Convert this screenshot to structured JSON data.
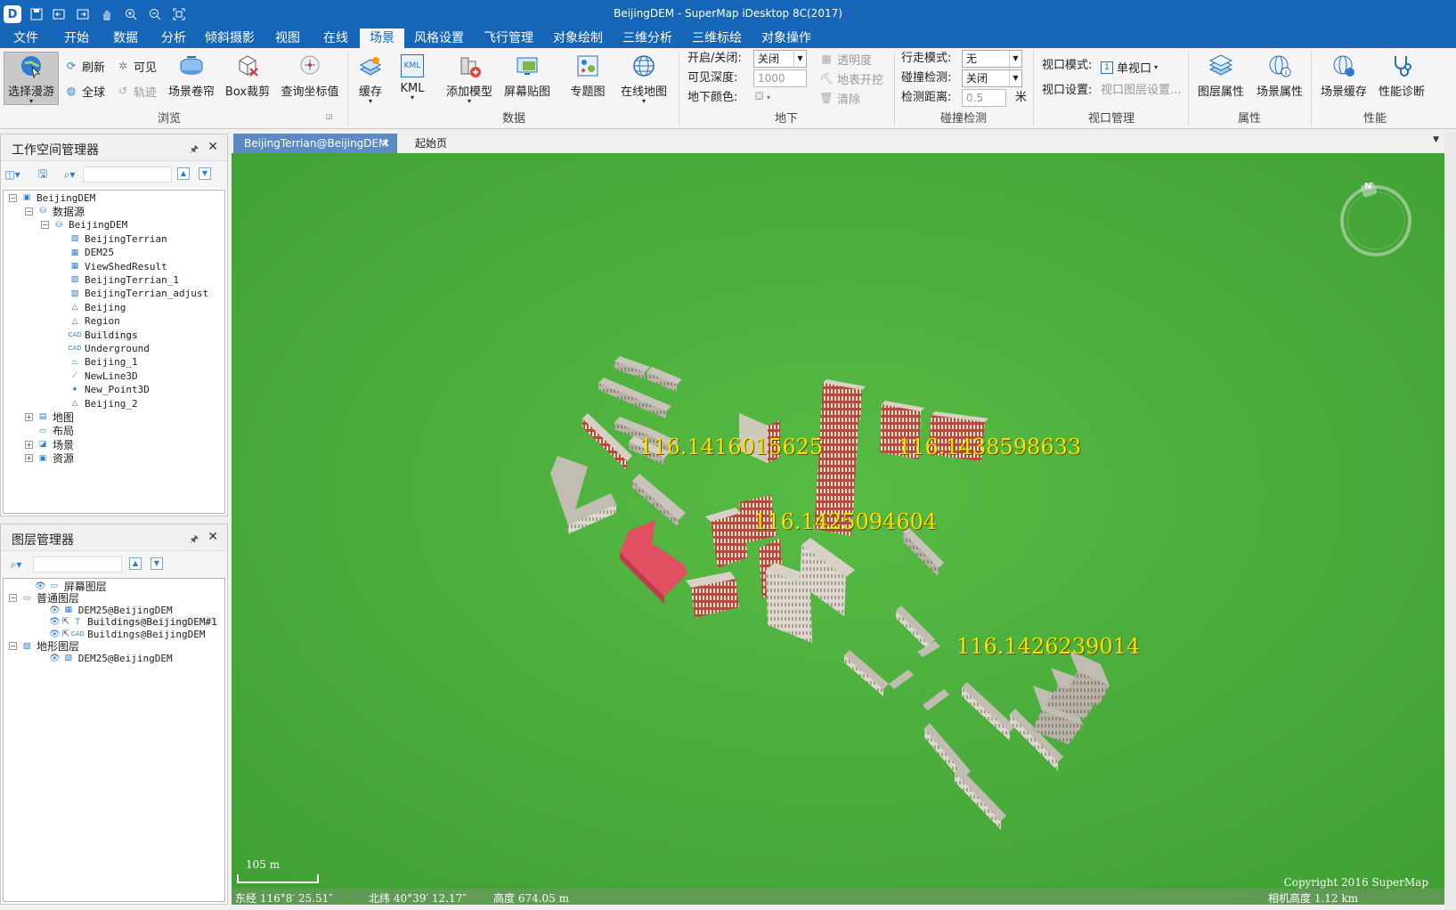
{
  "window": {
    "title": "BeijingDEM - SuperMap iDesktop 8C(2017)",
    "logo_text": "D"
  },
  "quick_access": [
    {
      "icon": "save-icon",
      "glyph": "🖫"
    },
    {
      "icon": "back-icon",
      "glyph": "⇤"
    },
    {
      "icon": "forward-icon",
      "glyph": "⇥"
    },
    {
      "icon": "pan-hand-icon",
      "glyph": "✋"
    },
    {
      "icon": "zoom-in-icon",
      "glyph": "⊕"
    },
    {
      "icon": "zoom-out-icon",
      "glyph": "⊖"
    },
    {
      "icon": "full-extent-icon",
      "glyph": "⛶"
    }
  ],
  "menu_tabs": [
    "文件",
    "开始",
    "数据",
    "分析",
    "倾斜摄影",
    "视图",
    "在线",
    "场景",
    "风格设置",
    "飞行管理",
    "对象绘制",
    "三维分析",
    "三维标绘",
    "对象操作"
  ],
  "active_menu_tab": "场景",
  "ribbon": {
    "browse": {
      "label": "浏览",
      "select_roam": "选择漫游",
      "refresh": "刷新",
      "visible": "可见",
      "full_globe": "全球",
      "track": "轨迹",
      "scene_roller": "场景卷帘",
      "box_clip": "Box裁剪",
      "query_coord": "查询坐标值"
    },
    "data": {
      "label": "数据",
      "cache": "缓存",
      "kml": "KML",
      "kml_icon_text": "KML",
      "add_model": "添加模型",
      "screen_paste": "屏幕贴图",
      "thematic": "专题图",
      "online_map": "在线地图"
    },
    "underground": {
      "label": "地下",
      "on_off_label": "开启/关闭:",
      "on_off_value": "关闭",
      "depth_label": "可见深度:",
      "depth_value": "1000",
      "color_label": "地下颜色:",
      "transparency": "透明度",
      "surface_dig": "地表开挖",
      "clear": "清除"
    },
    "collision": {
      "label": "碰撞检测",
      "walk_mode_label": "行走模式:",
      "walk_mode_value": "无",
      "collision_label": "碰撞检测:",
      "collision_value": "关闭",
      "distance_label": "检测距离:",
      "distance_value": "0.5",
      "unit": "米"
    },
    "viewport": {
      "label": "视口管理",
      "mode_label": "视口模式:",
      "mode_value": "单视口",
      "mode_icon_text": "1",
      "settings_label": "视口设置:",
      "settings_value": "视口图层设置..."
    },
    "properties": {
      "label": "属性",
      "layer_props": "图层属性",
      "scene_props": "场景属性"
    },
    "performance": {
      "label": "性能",
      "scene_cache": "场景缓存",
      "diagnosis": "性能诊断"
    }
  },
  "workspace_panel": {
    "title": "工作空间管理器",
    "pin_glyph": "🖈",
    "tree": [
      {
        "label": "BeijingDEM",
        "level": 0,
        "icon": "workspace-icon",
        "exp": "⊟",
        "cn": false
      },
      {
        "label": "数据源",
        "level": 1,
        "icon": "datasources-icon",
        "exp": "⊟",
        "cn": true
      },
      {
        "label": "BeijingDEM",
        "level": 2,
        "icon": "database-icon",
        "exp": "⊟",
        "cn": false
      },
      {
        "label": "BeijingTerrian",
        "level": 3,
        "icon": "image-dataset-icon",
        "exp": "",
        "cn": false
      },
      {
        "label": "DEM25",
        "level": 3,
        "icon": "grid-dataset-icon",
        "exp": "",
        "cn": false
      },
      {
        "label": "ViewShedResult",
        "level": 3,
        "icon": "grid-dataset-icon",
        "exp": "",
        "cn": false
      },
      {
        "label": "BeijingTerrian_1",
        "level": 3,
        "icon": "image-dataset-icon",
        "exp": "",
        "cn": false
      },
      {
        "label": "BeijingTerrian_adjust",
        "level": 3,
        "icon": "image-dataset-icon",
        "exp": "",
        "cn": false
      },
      {
        "label": "Beijing",
        "level": 3,
        "icon": "region-dataset-icon",
        "exp": "",
        "cn": false
      },
      {
        "label": "Region",
        "level": 3,
        "icon": "region-dataset-icon",
        "exp": "",
        "cn": false
      },
      {
        "label": "Buildings",
        "level": 3,
        "icon": "cad-dataset-icon",
        "exp": "",
        "cn": false,
        "hl": true
      },
      {
        "label": "Underground",
        "level": 3,
        "icon": "cad-dataset-icon",
        "exp": "",
        "cn": false
      },
      {
        "label": "Beijing_1",
        "level": 3,
        "icon": "region3d-dataset-icon",
        "exp": "",
        "cn": false
      },
      {
        "label": "NewLine3D",
        "level": 3,
        "icon": "line3d-dataset-icon",
        "exp": "",
        "cn": false
      },
      {
        "label": "New_Point3D",
        "level": 3,
        "icon": "point3d-dataset-icon",
        "exp": "",
        "cn": false
      },
      {
        "label": "Beijing_2",
        "level": 3,
        "icon": "region-dataset-icon",
        "exp": "",
        "cn": false
      },
      {
        "label": "地图",
        "level": 1,
        "icon": "maps-icon",
        "exp": "⊞",
        "cn": true
      },
      {
        "label": "布局",
        "level": 1,
        "icon": "layouts-icon",
        "exp": "",
        "cn": true
      },
      {
        "label": "场景",
        "level": 1,
        "icon": "scenes-icon",
        "exp": "⊞",
        "cn": true
      },
      {
        "label": "资源",
        "level": 1,
        "icon": "resources-icon",
        "exp": "⊞",
        "cn": true
      }
    ]
  },
  "layer_panel": {
    "title": "图层管理器",
    "pin_glyph": "🖈",
    "tree": [
      {
        "label": "屏幕图层",
        "level": 1,
        "icon": "screen-layer-icon",
        "exp": "",
        "cn": true,
        "eye": true
      },
      {
        "label": "普通图层",
        "level": 0,
        "icon": "normal-layers-icon",
        "exp": "⊟",
        "cn": true,
        "eye": false
      },
      {
        "label": "DEM25@BeijingDEM",
        "level": 2,
        "icon": "grid-dataset-icon",
        "exp": "",
        "cn": false,
        "eye": true
      },
      {
        "label": "Buildings@BeijingDEM#1",
        "level": 2,
        "icon": "text-layer-icon",
        "exp": "",
        "cn": false,
        "eye": true,
        "select": true,
        "hl": true
      },
      {
        "label": "Buildings@BeijingDEM",
        "level": 2,
        "icon": "cad-dataset-icon",
        "exp": "",
        "cn": false,
        "eye": true,
        "select": true
      },
      {
        "label": "地形图层",
        "level": 0,
        "icon": "terrain-layers-icon",
        "exp": "⊟",
        "cn": true,
        "eye": false
      },
      {
        "label": "DEM25@BeijingDEM",
        "level": 2,
        "icon": "terrain-layer-icon",
        "exp": "",
        "cn": false,
        "eye": true
      }
    ]
  },
  "doc_tabs": [
    {
      "label": "BeijingTerrian@BeijingDEM",
      "active": true
    },
    {
      "label": "起始页",
      "active": false
    }
  ],
  "scene": {
    "coord_labels": [
      "116.1416015625",
      "116.1438598633",
      "116.1425094604",
      "116.1426239014"
    ],
    "scale_text": "105 m",
    "copyright": "Copyright 2016 SuperMap",
    "status": {
      "longitude": "东经 116°8′ 25.51″",
      "latitude": "北纬 40°39′ 12.17″",
      "elevation": "高度 674.05 m",
      "camera_height": "相机高度 1.12 km"
    },
    "compass_letter": "N"
  },
  "colors": {
    "titlebar": "#1565b8",
    "ground": "#4eb23c",
    "label_yellow": "#f6e200",
    "highlight_building": "#e05060"
  }
}
